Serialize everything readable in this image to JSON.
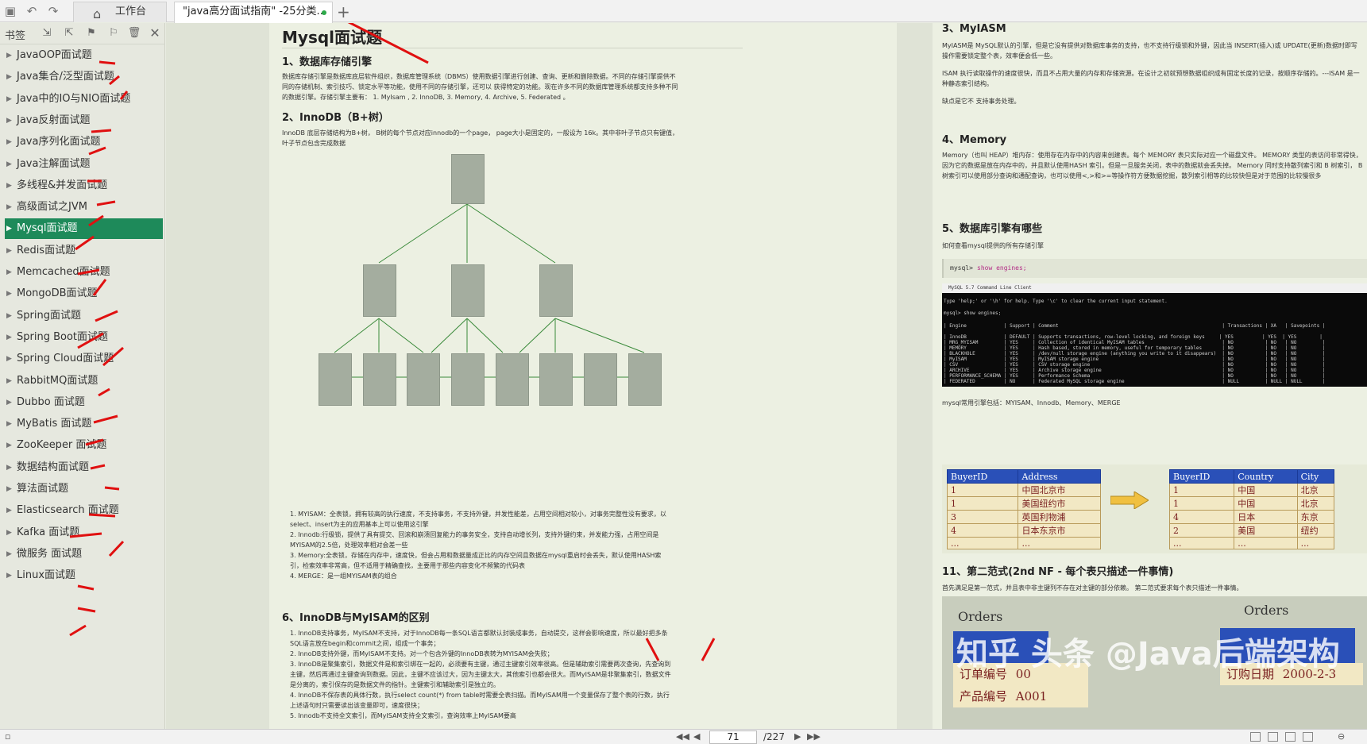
{
  "tabs": {
    "home_label": "工作台",
    "doc_label": "\"java高分面试指南\" -25分类..."
  },
  "sidebar": {
    "title": "书签",
    "items": [
      {
        "label": "JavaOOP面试题"
      },
      {
        "label": "Java集合/泛型面试题"
      },
      {
        "label": "Java中的IO与NIO面试题"
      },
      {
        "label": "Java反射面试题"
      },
      {
        "label": "Java序列化面试题"
      },
      {
        "label": "Java注解面试题"
      },
      {
        "label": "多线程&并发面试题"
      },
      {
        "label": "高级面试之JVM"
      },
      {
        "label": "Mysql面试题",
        "active": true
      },
      {
        "label": "Redis面试题"
      },
      {
        "label": "Memcached面试题"
      },
      {
        "label": "MongoDB面试题"
      },
      {
        "label": "Spring面试题"
      },
      {
        "label": "Spring Boot面试题"
      },
      {
        "label": "Spring Cloud面试题"
      },
      {
        "label": "RabbitMQ面试题"
      },
      {
        "label": "Dubbo 面试题"
      },
      {
        "label": "MyBatis 面试题"
      },
      {
        "label": "ZooKeeper 面试题"
      },
      {
        "label": "数据结构面试题"
      },
      {
        "label": "算法面试题"
      },
      {
        "label": "Elasticsearch 面试题"
      },
      {
        "label": "Kafka 面试题"
      },
      {
        "label": "微服务 面试题"
      },
      {
        "label": "Linux面试题"
      }
    ]
  },
  "left_page": {
    "title": "Mysql面试题",
    "s1_heading": "1、数据库存储引擎",
    "s1_text": "数据库存储引擎是数据库底层软件组织，数据库管理系统（DBMS）使用数据引擎进行创建、查询、更新和删除数据。不同的存储引擎提供不同的存储机制、索引技巧、锁定水平等功能，使用不同的存储引擎，还可以 获得特定的功能。现在许多不同的数据库管理系统都支持多种不同的数据引擎。存储引擎主要有： 1. MyIsam , 2. InnoDB, 3. Memory, 4. Archive, 5. Federated 。",
    "s2_heading": "2、InnoDB（B+树）",
    "s2_text": "InnoDB 底层存储结构为B+树， B树的每个节点对应innodb的一个page， page大小是固定的，一般设为 16k。其中非叶子节点只有键值，叶子节点包含完成数据",
    "list_a": [
      "1. MYISAM：全表锁，拥有较高的执行速度，不支持事务，不支持外键，并发性能差，占用空间相对较小，对事务完整性没有要求，以select、insert为主的应用基本上可以使用这引擎",
      "2. Innodb:行级锁，提供了具有提交、回滚和崩溃回复能力的事务安全，支持自动增长列，支持外键约束，并发能力强，占用空间是MYISAM的2.5倍，处理效率相对会差一些",
      "3. Memory:全表锁，存储在内存中，速度快，但会占用和数据量成正比的内存空间且数据在mysql重启时会丢失，默认使用HASH索引，检索效率非常高，但不适用于精确查找，主要用于那些内容变化不频繁的代码表",
      "4. MERGE：是一组MYISAM表的组合"
    ],
    "s6_heading": "6、InnoDB与MyISAM的区别",
    "list_b": [
      "1. InnoDB支持事务，MyISAM不支持，对于InnoDB每一条SQL语言都默认封装成事务，自动提交，这样会影响速度，所以最好把多条SQL语言放在begin和commit之间，组成一个事务；",
      "2. InnoDB支持外键，而MyISAM不支持。对一个包含外键的InnoDB表转为MYISAM会失败；",
      "3. InnoDB是聚集索引，数据文件是和索引绑在一起的，必须要有主键，通过主键索引效率很高。但是辅助索引需要两次查询，先查询到主键，然后再通过主键查询到数据。因此，主键不应该过大，因为主键太大，其他索引也都会很大。而MyISAM是非聚集索引，数据文件是分离的，索引保存的是数据文件的指针。主键索引和辅助索引是独立的。",
      "4. InnoDB不保存表的具体行数，执行select count(*) from table时需要全表扫描。而MyISAM用一个变量保存了整个表的行数，执行上述语句时只需要读出该变量即可，速度很快；",
      "5. Innodb不支持全文索引，而MyISAM支持全文索引，查询效率上MyISAM要高"
    ]
  },
  "right_page": {
    "s3_heading": "3、MyIASM",
    "s3_text1": "MyIASM是 MySQL默认的引擎，但是它没有提供对数据库事务的支持，也不支持行级锁和外键，因此当 INSERT(插入)或 UPDATE(更新)数据时即写操作需要锁定整个表，效率便会低一些。",
    "s3_text2": "ISAM 执行读取操作的速度很快，而且不占用大量的内存和存储资源。在设计之初就预想数据组织成有固定长度的记录，按顺序存储的。---ISAM 是一种静态索引结构。",
    "s3_text3": "缺点是它不 支持事务处理。",
    "s4_heading": "4、Memory",
    "s4_text": "Memory（也叫 HEAP）堆内存：使用存在内存中的内容来创建表。每个 MEMORY 表只实际对应一个磁盘文件。 MEMORY 类型的表访问非常得快，因为它的数据是放在内存中的，并且默认使用HASH 索引。但是一旦服务关闭，表中的数据就会丢失掉。 Memory 同时支持散列索引和 B 树索引， B树索引可以使用部分查询和通配查询，也可以使用<,>和>=等操作符方便数据挖掘，散列索引相等的比较快但是对于范围的比较慢很多",
    "s5_heading": "5、数据库引擎有哪些",
    "s5_text": "如何查看mysql提供的所有存储引擎",
    "code_prompt": "mysql>",
    "code_cmd": "show engines;",
    "terminal_title": "MySQL 5.7 Command Line Client",
    "terminal_line1": "Type 'help;' or '\\h' for help. Type '\\c' to clear the current input statement.",
    "terminal_line2": "mysql> show engines;",
    "terminal_header": "| Engine             | Support | Comment                                                         | Transactions | XA   | Savepoints |",
    "terminal_rows": [
      "| InnoDB             | DEFAULT | Supports transactions, row-level locking, and foreign keys     | YES          | YES  | YES        |",
      "| MRG_MYISAM         | YES     | Collection of identical MyISAM tables                           | NO           | NO   | NO         |",
      "| MEMORY             | YES     | Hash based, stored in memory, useful for temporary tables       | NO           | NO   | NO         |",
      "| BLACKHOLE          | YES     | /dev/null storage engine (anything you write to it disappears)  | NO           | NO   | NO         |",
      "| MyISAM             | YES     | MyISAM storage engine                                           | NO           | NO   | NO         |",
      "| CSV                | YES     | CSV storage engine                                              | NO           | NO   | NO         |",
      "| ARCHIVE            | YES     | Archive storage engine                                          | NO           | NO   | NO         |",
      "| PERFORMANCE_SCHEMA | YES     | Performance Schema                                              | NO           | NO   | NO         |",
      "| FEDERATED          | NO      | Federated MySQL storage engine                                  | NULL         | NULL | NULL       |"
    ],
    "s5_caption": "mysql常用引擎包括：MYISAM、Innodb、Memory、MERGE",
    "table_left": {
      "headers": [
        "BuyerID",
        "Address"
      ],
      "rows": [
        [
          "1",
          "中国北京市"
        ],
        [
          "1",
          "美国纽约市"
        ],
        [
          "3",
          "英国利物浦"
        ],
        [
          "4",
          "日本东京市"
        ],
        [
          "...",
          "..."
        ]
      ]
    },
    "table_right": {
      "headers": [
        "BuyerID",
        "Country",
        "City"
      ],
      "rows": [
        [
          "1",
          "中国",
          "北京"
        ],
        [
          "1",
          "中国",
          "北京"
        ],
        [
          "4",
          "日本",
          "东京"
        ],
        [
          "2",
          "美国",
          "纽约"
        ],
        [
          "...",
          "...",
          "..."
        ]
      ]
    },
    "s11_heading": "11、第二范式(2nd NF - 每个表只描述一件事情)",
    "s11_text": "首先满足是第一范式，并且表中非主键列不存在对主键的部分依赖。 第二范式要求每个表只描述一件事情。",
    "orders_label_left": "Orders",
    "orders_label_right": "Orders",
    "orders_row_left": "订单编号",
    "orders_row_left_val": "00",
    "orders_row_left2": "产品编号",
    "orders_row_left2_val": "A001",
    "orders_row_right": "订购日期",
    "orders_row_right_val": "2000-2-3",
    "watermark": "知乎 头条 @Java后端架构"
  },
  "footer": {
    "current_page": "71",
    "total_pages": "/227"
  },
  "colors": {
    "accent_active": "#1e8a5a",
    "annotation_red": "#e01010",
    "tree_node": "#a4ad9f",
    "tree_edge": "#3a8a3a"
  }
}
